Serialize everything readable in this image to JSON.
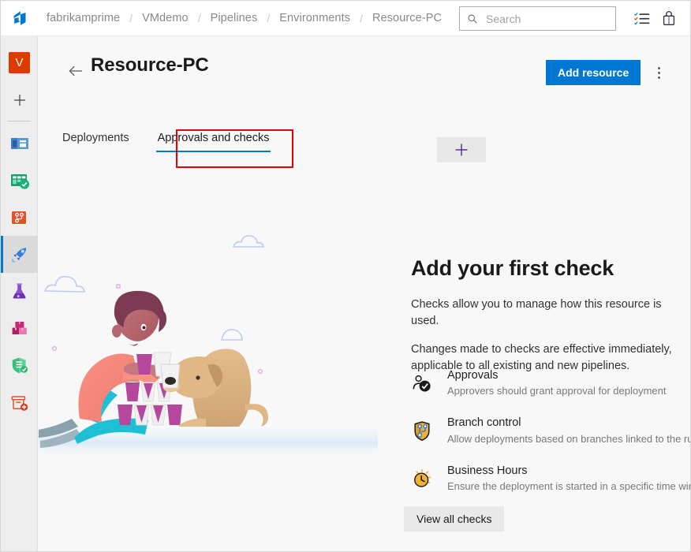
{
  "topbar": {
    "logo_icon": "azure-devops-logo-icon",
    "breadcrumb": [
      {
        "label": "fabrikamprime"
      },
      {
        "label": "VMdemo"
      },
      {
        "label": "Pipelines"
      },
      {
        "label": "Environments"
      },
      {
        "label": "Resource-PC"
      }
    ],
    "separator": "/",
    "search": {
      "placeholder": "Search",
      "value": "",
      "icon": "search-icon"
    },
    "actions": [
      {
        "name": "tasks-icon",
        "label": "Tasks"
      },
      {
        "name": "briefcase-icon",
        "label": "Marketplace"
      }
    ]
  },
  "rail": {
    "avatar": {
      "initial": "V",
      "color": "#dd3b00"
    },
    "add_label": "+",
    "items": [
      {
        "name": "overview-icon",
        "label": "Overview",
        "selected": false
      },
      {
        "name": "boards-icon",
        "label": "Boards",
        "selected": false
      },
      {
        "name": "repos-icon",
        "label": "Repos",
        "selected": false
      },
      {
        "name": "pipelines-icon",
        "label": "Pipelines",
        "selected": true
      },
      {
        "name": "test-plans-icon",
        "label": "Test Plans",
        "selected": false
      },
      {
        "name": "artifacts-icon",
        "label": "Artifacts",
        "selected": false
      },
      {
        "name": "security-icon",
        "label": "Advanced Security",
        "selected": false
      },
      {
        "name": "add-extension-icon",
        "label": "Add extension",
        "selected": false
      }
    ]
  },
  "page": {
    "back_icon": "back-arrow-icon",
    "title": "Resource-PC",
    "primary_button": "Add resource",
    "more_icon": "more-options-icon",
    "tabs": [
      {
        "label": "Deployments",
        "active": false
      },
      {
        "label": "Approvals and checks",
        "active": true
      }
    ],
    "highlight_color": "#e60000",
    "accent_color": "#0078d4",
    "plus_button": "+"
  },
  "empty_state": {
    "heading": "Add your first check",
    "paragraph1": "Checks allow you to manage how this resource is used.",
    "paragraph2": "Changes made to checks are effective immediately, applicable to all existing and new pipelines.",
    "checks": [
      {
        "icon": "approvals-icon",
        "title": "Approvals",
        "description": "Approvers should grant approval for deployment"
      },
      {
        "icon": "branch-control-icon",
        "title": "Branch control",
        "description": "Allow deployments based on branches linked to the run"
      },
      {
        "icon": "business-hours-icon",
        "title": "Business Hours",
        "description": "Ensure the deployment is started in a specific time win..."
      }
    ],
    "view_all_button": "View all checks",
    "illustration": "person-stacking-cups-with-dog-illustration"
  }
}
